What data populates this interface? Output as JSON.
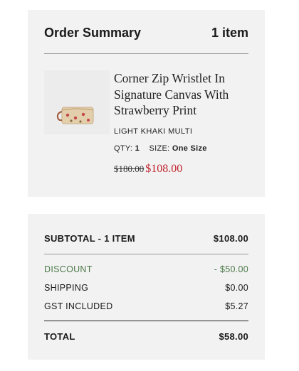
{
  "summary": {
    "title": "Order Summary",
    "item_count": "1 item"
  },
  "product": {
    "name": "Corner Zip Wristlet In Signature Canvas With Strawberry Print",
    "color": "LIGHT KHAKI MULTI",
    "qty_label": "QTY:",
    "qty_value": "1",
    "size_label": "SIZE:",
    "size_value": "One Size",
    "original_price": "$180.00",
    "sale_price": "$108.00",
    "sale_color": "#c0222c"
  },
  "totals": {
    "subtotal_label": "SUBTOTAL - 1 ITEM",
    "subtotal_value": "$108.00",
    "discount_label": "DISCOUNT",
    "discount_value": "- $50.00",
    "discount_color": "#4d7a4a",
    "shipping_label": "SHIPPING",
    "shipping_value": "$0.00",
    "gst_label": "GST INCLUDED",
    "gst_value": "$5.27",
    "total_label": "TOTAL",
    "total_value": "$58.00"
  }
}
